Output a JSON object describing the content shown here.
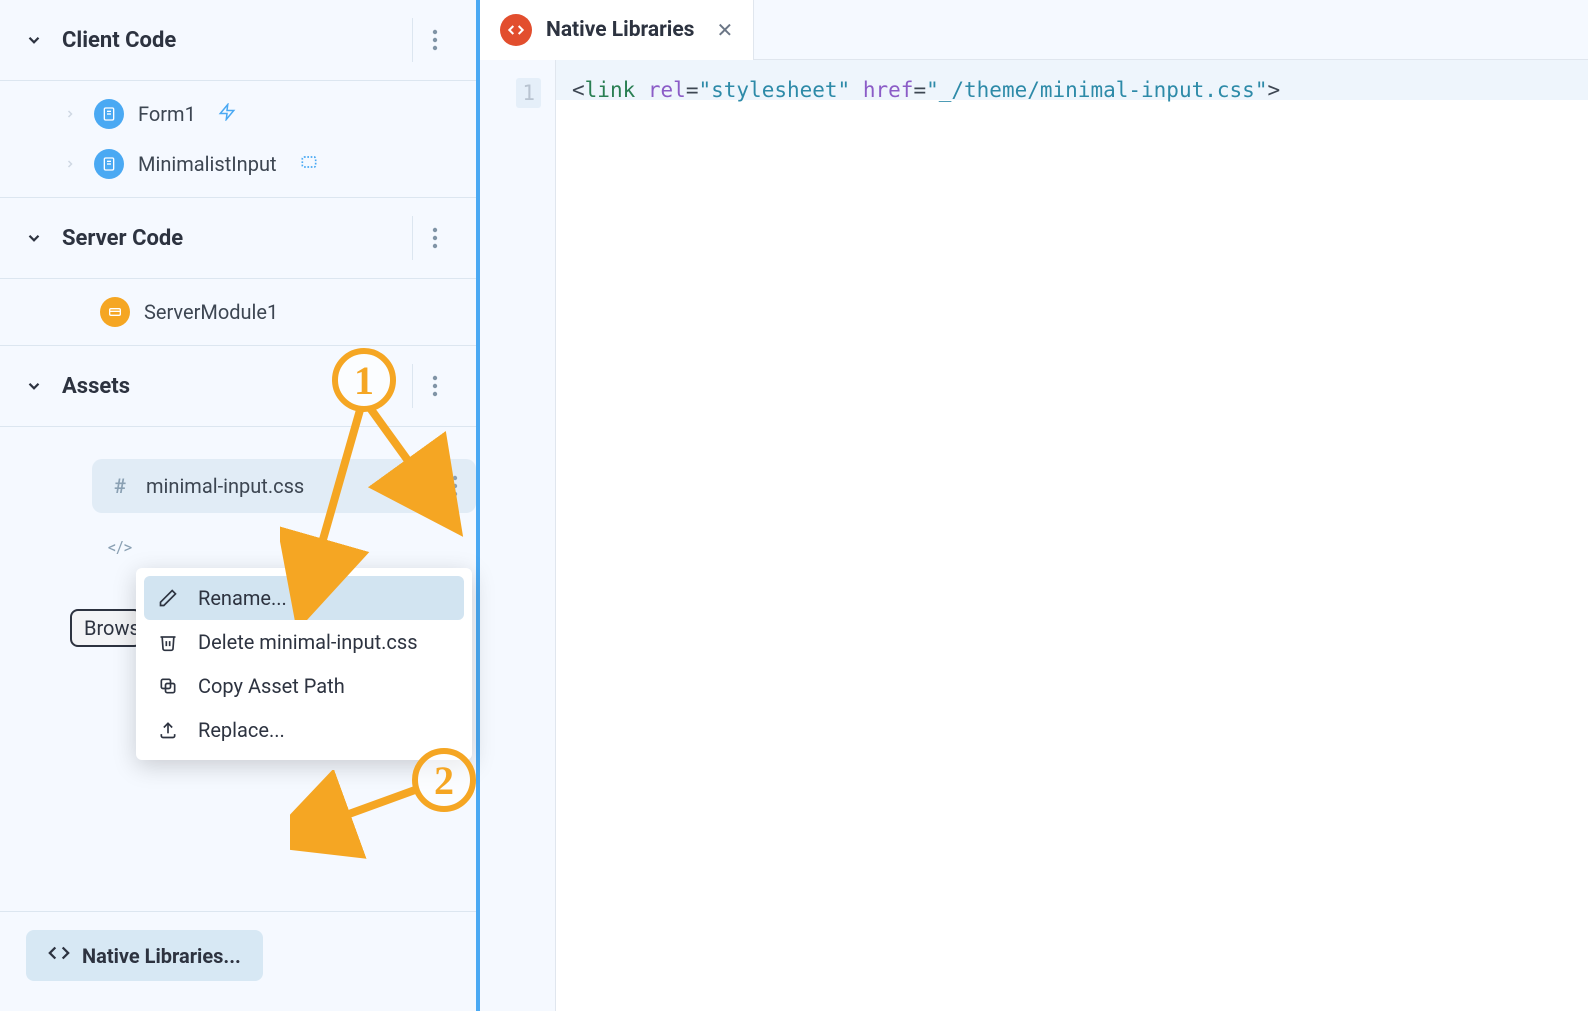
{
  "sidebar": {
    "sections": {
      "client_code": {
        "title": "Client Code"
      },
      "server_code": {
        "title": "Server Code"
      },
      "assets": {
        "title": "Assets"
      }
    },
    "client_items": [
      {
        "label": "Form1",
        "has_bolt": true
      },
      {
        "label": "MinimalistInput",
        "has_layout": true
      }
    ],
    "server_items": [
      {
        "label": "ServerModule1"
      }
    ],
    "assets_items": [
      {
        "label": "minimal-input.css",
        "prefix": "#"
      },
      {
        "label": "",
        "prefix": "</>"
      }
    ],
    "browse_label": "Brows",
    "native_libraries_label": "Native Libraries..."
  },
  "context_menu": [
    {
      "label": "Rename...",
      "icon": "pencil",
      "hover": true
    },
    {
      "label": "Delete minimal-input.css",
      "icon": "trash",
      "hover": false
    },
    {
      "label": "Copy Asset Path",
      "icon": "copy",
      "hover": false
    },
    {
      "label": "Replace...",
      "icon": "upload",
      "hover": false
    }
  ],
  "editor": {
    "tab": {
      "label": "Native Libraries",
      "icon": "</>"
    },
    "line_number": "1",
    "code": {
      "lt": "<",
      "tag": "link",
      "attr_rel": "rel",
      "eq": "=",
      "val_rel": "\"stylesheet\"",
      "attr_href": "href",
      "val_href": "\"_/theme/minimal-input.css\"",
      "gt": ">"
    }
  },
  "annotations": {
    "one": "1",
    "two": "2"
  }
}
